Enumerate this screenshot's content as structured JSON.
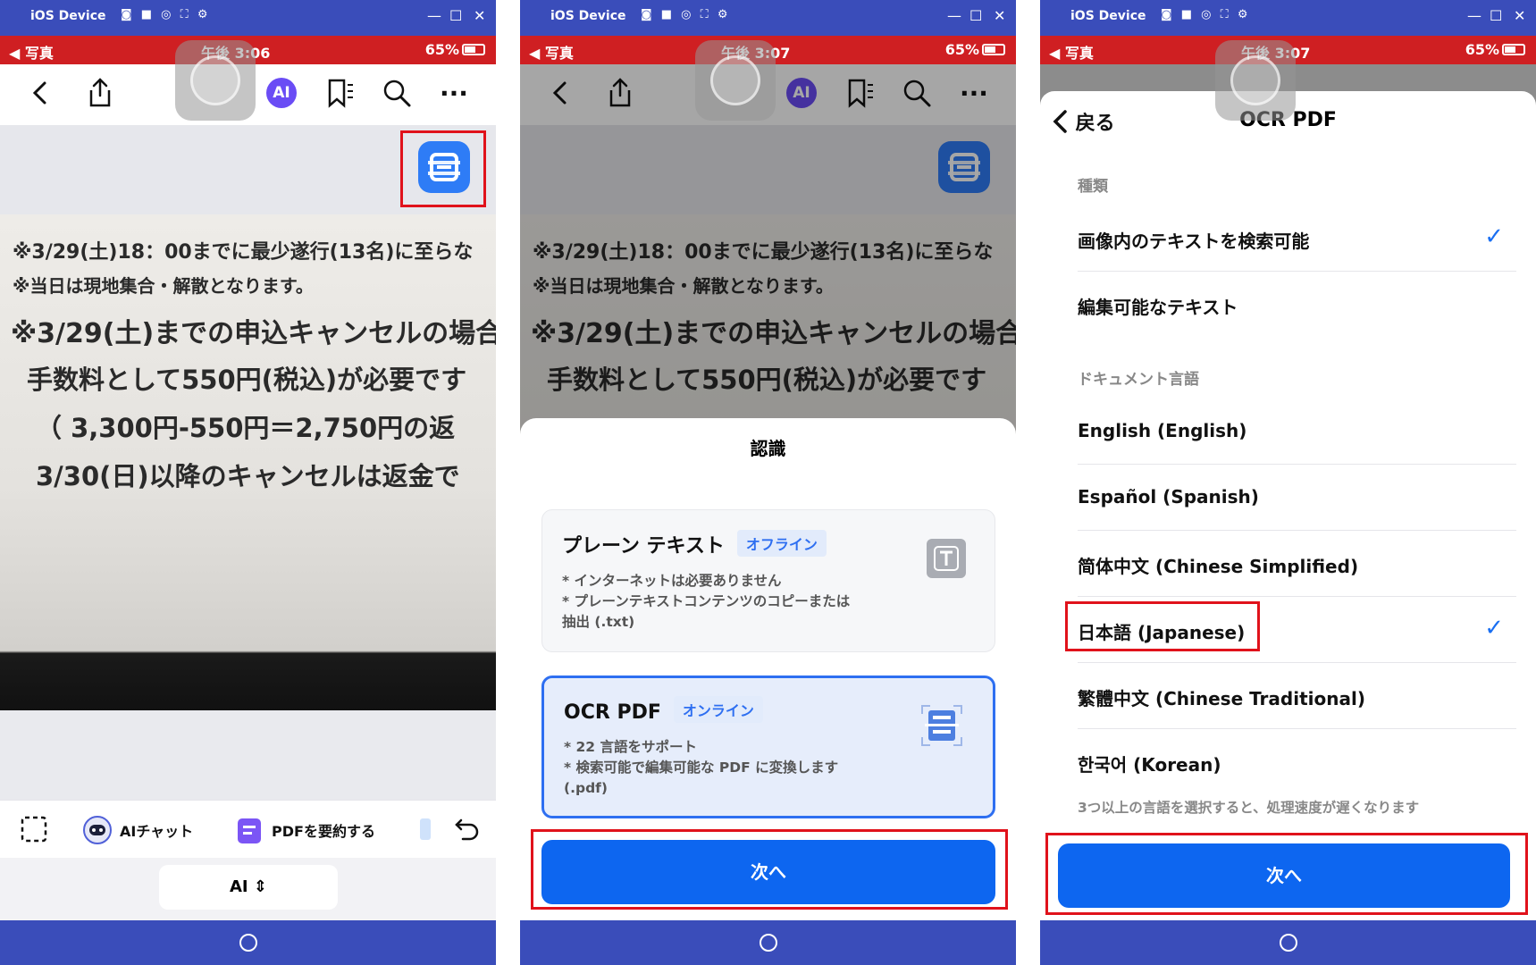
{
  "device": {
    "name": "iOS Device",
    "toolbar_icons": "◙ ■ ◎ ⛶ ⚙",
    "minimize": "—",
    "maximize": "☐",
    "close": "✕"
  },
  "status": {
    "app": "◀ 写真",
    "time1": "午後 3:06",
    "time2": "午後 3:07",
    "battery": "65%"
  },
  "colors": {
    "window_bar": "#3a4dba",
    "status_bar": "#cf1f22",
    "accent": "#0d66f0",
    "highlight": "#e0121b"
  },
  "toolbar": {
    "back_icon": "chevron-left-icon",
    "share_icon": "share-icon",
    "ai": "AI",
    "bookmark_icon": "bookmark-icon",
    "search_icon": "search-icon",
    "more": "···"
  },
  "document": {
    "lines": [
      "※3/29(土)18：00までに最少遂行(13名)に至らな",
      "※当日は現地集合・解散となります。",
      "※3/29(土)までの申込キャンセルの場合",
      "手数料として550円(税込)が必要です",
      "（ 3,300円-550円＝2,750円の返",
      "3/30(日)以降のキャンセルは返金で"
    ]
  },
  "bottom": {
    "ai_chat": "AIチャット",
    "summarize": "PDFを要約する",
    "ai_tab": "AI",
    "ai_tab_arrows": "⇕"
  },
  "sheet": {
    "title": "認識",
    "plain": {
      "title": "プレーン テキスト",
      "badge": "オフライン",
      "desc": [
        "* インターネットは必要ありません",
        "* プレーンテキストコンテンツのコピーまたは",
        "抽出 (.txt)"
      ]
    },
    "ocr": {
      "title": "OCR PDF",
      "badge": "オンライン",
      "desc": [
        "* 22 言語をサポート",
        "* 検索可能で編集可能な PDF に変換します",
        "(.pdf)"
      ]
    },
    "next": "次へ"
  },
  "ocr_settings": {
    "back": "戻る",
    "title": "OCR PDF",
    "type_header": "種類",
    "types": [
      {
        "label": "画像内のテキストを検索可能",
        "checked": true
      },
      {
        "label": "編集可能なテキスト",
        "checked": false
      }
    ],
    "lang_header": "ドキュメント言語",
    "languages": [
      {
        "label": "English (English)",
        "checked": false
      },
      {
        "label": "Español (Spanish)",
        "checked": false
      },
      {
        "label": "简体中文 (Chinese Simplified)",
        "checked": false
      },
      {
        "label": "日本語 (Japanese)",
        "checked": true
      },
      {
        "label": "繁體中文 (Chinese Traditional)",
        "checked": false
      },
      {
        "label": "한국어 (Korean)",
        "checked": false
      }
    ],
    "note": "3つ以上の言語を選択すると、処理速度が遅くなります",
    "check": "✓",
    "next": "次へ"
  }
}
